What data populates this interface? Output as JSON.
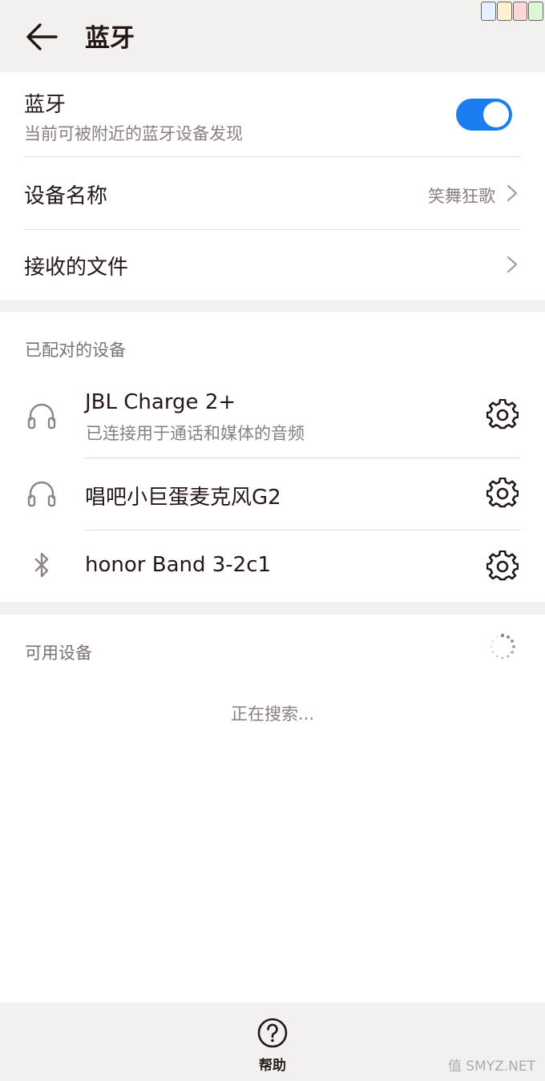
{
  "header": {
    "title": "蓝牙",
    "back_icon": "arrow-left-icon"
  },
  "bluetooth": {
    "label": "蓝牙",
    "description": "当前可被附近的蓝牙设备发现",
    "enabled": true,
    "toggle_color": "#1a7ef0"
  },
  "device_name": {
    "label": "设备名称",
    "value": "笑舞狂歌"
  },
  "received_files": {
    "label": "接收的文件"
  },
  "paired": {
    "section_title": "已配对的设备",
    "devices": [
      {
        "name": "JBL Charge 2+",
        "status": "已连接用于通话和媒体的音频",
        "icon": "headphones-icon"
      },
      {
        "name": "唱吧小巨蛋麦克风G2",
        "status": "",
        "icon": "headphones-icon"
      },
      {
        "name": "honor Band 3-2c1",
        "status": "",
        "icon": "bluetooth-icon"
      }
    ]
  },
  "available": {
    "section_title": "可用设备",
    "searching_text": "正在搜索..."
  },
  "bottom": {
    "help_label": "帮助"
  },
  "watermark": "值 SMYZ.NET"
}
